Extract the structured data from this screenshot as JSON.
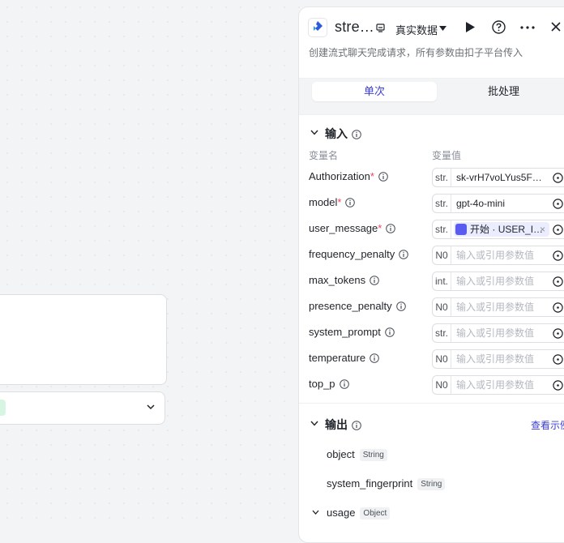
{
  "panel": {
    "title": "stre…",
    "mode_label": "真实数据",
    "description": "创建流式聊天完成请求，所有参数由扣子平台传入",
    "tabs": [
      {
        "label": "单次",
        "active": true
      },
      {
        "label": "批处理",
        "active": false
      }
    ]
  },
  "input": {
    "title": "输入",
    "col_name": "变量名",
    "col_value": "变量值",
    "placeholder": "输入或引用参数值",
    "params": [
      {
        "name": "Authorization",
        "required": "*",
        "type": "str.",
        "value": "sk-vrH7voLYus5F…"
      },
      {
        "name": "model",
        "required": "*",
        "type": "str.",
        "value": "gpt-4o-mini"
      },
      {
        "name": "user_message",
        "required": "*",
        "type": "str.",
        "ref_node": "开始",
        "ref_var": "USER_I…"
      },
      {
        "name": "frequency_penalty",
        "required": "",
        "type": "N0",
        "value": ""
      },
      {
        "name": "max_tokens",
        "required": "",
        "type": "int.",
        "value": ""
      },
      {
        "name": "presence_penalty",
        "required": "",
        "type": "N0",
        "value": ""
      },
      {
        "name": "system_prompt",
        "required": "",
        "type": "str.",
        "value": ""
      },
      {
        "name": "temperature",
        "required": "",
        "type": "N0",
        "value": ""
      },
      {
        "name": "top_p",
        "required": "",
        "type": "N0",
        "value": ""
      }
    ]
  },
  "output": {
    "title": "输出",
    "view_example": "查看示例",
    "fields": [
      {
        "name": "object",
        "type": "String"
      },
      {
        "name": "system_fingerprint",
        "type": "String"
      },
      {
        "name": "usage",
        "type": "Object"
      }
    ]
  },
  "colors": {
    "accent": "#3b3dd1",
    "required": "#f0435e",
    "ref_chip": "#ebedff"
  },
  "icons": [
    "app-logo-icon",
    "copy-icon",
    "caret-down-icon",
    "play-icon",
    "help-icon",
    "more-icon",
    "close-icon",
    "info-icon",
    "chevron-down-icon",
    "variable-icon"
  ]
}
